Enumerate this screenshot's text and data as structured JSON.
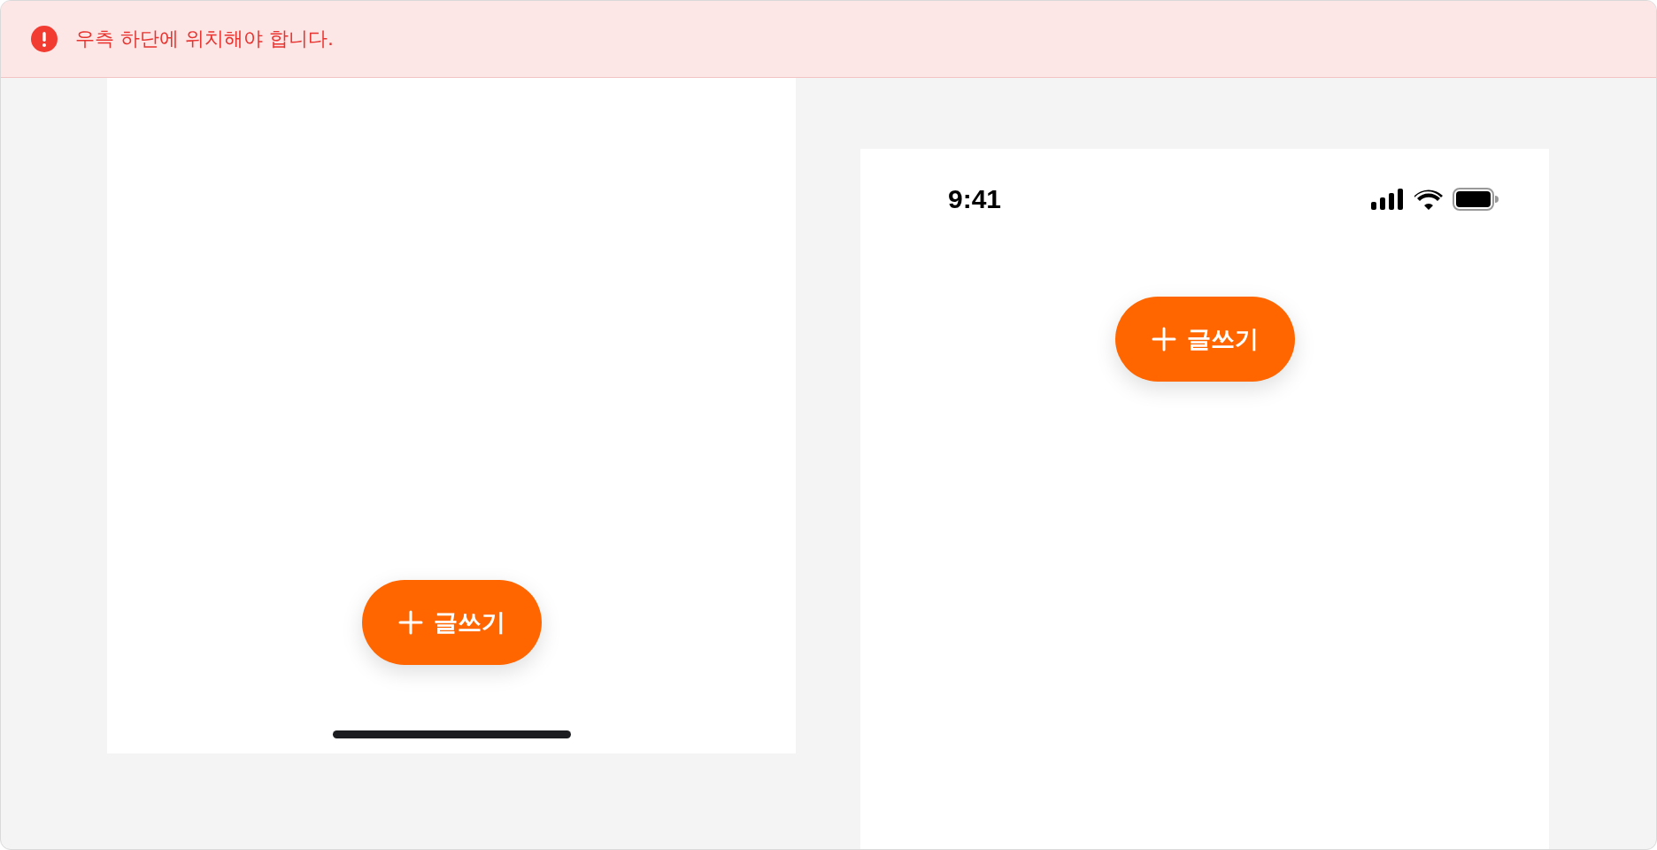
{
  "alert": {
    "kind": "error",
    "message": "우측 하단에 위치해야 합니다."
  },
  "phones": [
    {
      "kind": "fab-bottom",
      "fab": {
        "label": "글쓰기"
      }
    },
    {
      "kind": "fab-top",
      "status_bar": {
        "time": "9:41"
      },
      "fab": {
        "label": "글쓰기"
      }
    }
  ]
}
